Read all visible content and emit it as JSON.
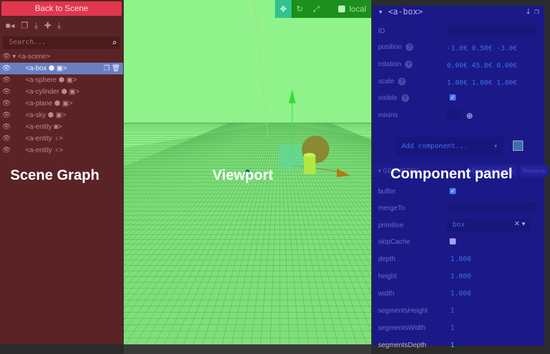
{
  "scene_graph": {
    "back_label": "Back to Scene",
    "toolbar_icons": [
      "camera-icon",
      "copy-icon",
      "download-icon",
      "plus-icon",
      "export-icon"
    ],
    "search_placeholder": "Search...",
    "items": [
      {
        "label": "▾ <a-scene>",
        "indent": false
      },
      {
        "label": "<a-box ⬢ ▣>",
        "selected": true
      },
      {
        "label": "<a-sphere ⬢ ▣>"
      },
      {
        "label": "<a-cylinder ⬢ ▣>"
      },
      {
        "label": "<a-plane ⬢ ▣>"
      },
      {
        "label": "<a-sky ⬢ ▣>"
      },
      {
        "label": "<a-entity ◙>"
      },
      {
        "label": "<a-entity ♁>"
      },
      {
        "label": "<a-entity ♁>"
      }
    ]
  },
  "viewport": {
    "toolbar": {
      "local_label": "local"
    }
  },
  "component_panel": {
    "entity_title": "<a-box>",
    "props": {
      "id": {
        "label": "ID"
      },
      "position": {
        "label": "position",
        "value": "-1.0€ 0.50€ -3.0€"
      },
      "rotation": {
        "label": "rotation",
        "value": "0.00€ 45.0€ 0.00€"
      },
      "scale": {
        "label": "scale",
        "value": "1.00€ 1.00€ 1.00€"
      },
      "visible": {
        "label": "visible",
        "checked": true
      },
      "mixins": {
        "label": "mixins"
      }
    },
    "add_component": "Add component...",
    "geometry": {
      "title": "GEOMETRY",
      "copy_label": "Copy Attributes",
      "remove_label": "Remove",
      "buffer": "buffer",
      "mergeTo": "mergeTo",
      "primitive": "primitive",
      "primitive_value": "box",
      "skipCache": "skipCache",
      "depth": "depth",
      "depth_value": "1.000",
      "height": "height",
      "height_value": "1.000",
      "width": "width",
      "width_value": "1.000",
      "segmentsHeight": "segmentsHeight",
      "segmentsHeight_value": "1",
      "segmentsWidth": "segmentsWidth",
      "segmentsWidth_value": "1",
      "segmentsDepth": "segmentsDepth",
      "segmentsDepth_value": "1"
    }
  },
  "overlay_labels": {
    "scene_graph": "Scene Graph",
    "viewport": "Viewport",
    "component_panel": "Component panel"
  }
}
